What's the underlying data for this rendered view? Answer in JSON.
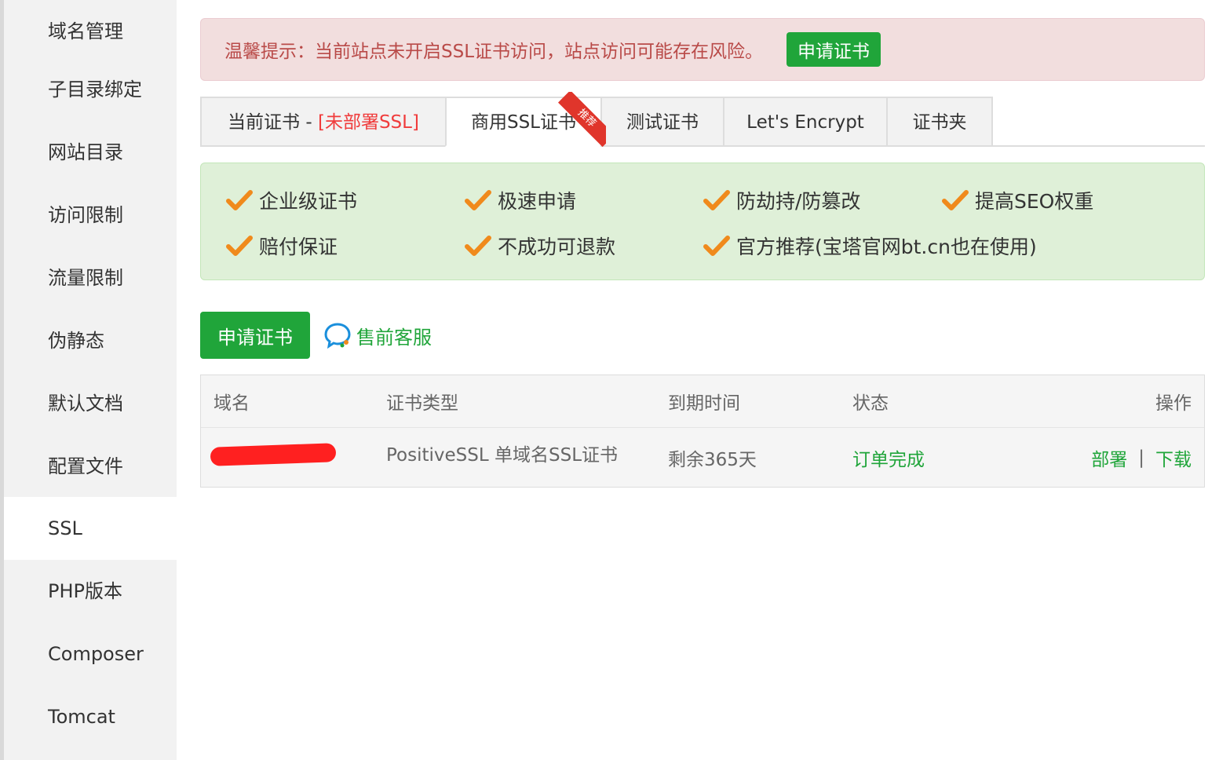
{
  "sidebar": {
    "items": [
      {
        "label": "域名管理"
      },
      {
        "label": "子目录绑定"
      },
      {
        "label": "网站目录"
      },
      {
        "label": "访问限制"
      },
      {
        "label": "流量限制"
      },
      {
        "label": "伪静态"
      },
      {
        "label": "默认文档"
      },
      {
        "label": "配置文件"
      },
      {
        "label": "SSL",
        "active": true
      },
      {
        "label": "PHP版本"
      },
      {
        "label": "Composer"
      },
      {
        "label": "Tomcat"
      }
    ]
  },
  "alert": {
    "text": "温馨提示：当前站点未开启SSL证书访问，站点访问可能存在风险。",
    "button": "申请证书"
  },
  "tabs": {
    "current_prefix": "当前证书 - ",
    "current_status": "[未部署SSL]",
    "commercial": "商用SSL证书",
    "ribbon": "推荐",
    "test": "测试证书",
    "letsencrypt": "Let's Encrypt",
    "folder": "证书夹"
  },
  "features": [
    "企业级证书",
    "极速申请",
    "防劫持/防篡改",
    "提高SEO权重",
    "赔付保证",
    "不成功可退款",
    "官方推荐(宝塔官网bt.cn也在使用)"
  ],
  "actions": {
    "apply": "申请证书",
    "service": "售前客服"
  },
  "table": {
    "headers": {
      "domain": "域名",
      "type": "证书类型",
      "expire": "到期时间",
      "status": "状态",
      "ops": "操作"
    },
    "rows": [
      {
        "type": "PositiveSSL 单域名SSL证书",
        "expire": "剩余365天",
        "status": "订单完成",
        "deploy": "部署",
        "sep": "|",
        "download": "下载"
      }
    ]
  },
  "colors": {
    "brand_green": "#20a53a",
    "alert_text": "#b94a48",
    "alert_bg": "#f2dede",
    "features_bg": "#dff0d8",
    "check_orange": "#f08a1c",
    "ribbon_red": "#e0352b"
  },
  "icons": {
    "check": "check-icon",
    "service": "chat-bubble-icon"
  }
}
